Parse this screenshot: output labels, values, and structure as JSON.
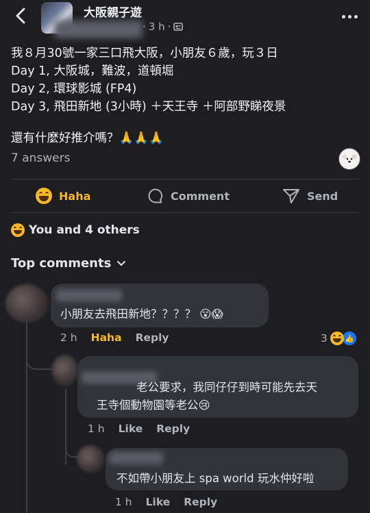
{
  "header": {
    "group_name": "大阪親子遊",
    "time": "3 h",
    "separator": "·"
  },
  "post": {
    "lines": [
      "我８月30號一家三口飛大阪，小朋友６歲，玩３日",
      "Day 1, 大阪城，難波，道頓堀",
      "Day 2, 環球影城 (FP4)",
      "Day 3, 飛田新地 (3小時) ＋天王寺 ＋阿部野睇夜景",
      "還有什麼好推介嗎？🙏🙏🙏"
    ],
    "answers_count": "7 answers"
  },
  "actions": {
    "haha": "Haha",
    "comment": "Comment",
    "send": "Send"
  },
  "reactions": {
    "summary": "You and 4 others"
  },
  "comments_section": {
    "title": "Top comments"
  },
  "comments": [
    {
      "text": "小朋友去飛田新地？？？？ 😮😱",
      "time": "2 h",
      "reaction": "Haha",
      "reply": "Reply",
      "reaction_count": "3"
    },
    {
      "text_line1": "老公要求，我同仔仔到時可能先去天",
      "text_line2": "王寺個動物園等老公😢",
      "time": "1 h",
      "like": "Like",
      "reply": "Reply"
    },
    {
      "text": "不如帶小朋友上 spa world 玩水仲好啦",
      "time": "1 h",
      "like": "Like",
      "reply": "Reply"
    }
  ],
  "colors": {
    "background": "#1e1e21",
    "bubble": "#333438",
    "haha_accent": "#f7b928",
    "like_blue": "#1877f2",
    "muted_text": "#b0b3b8"
  }
}
